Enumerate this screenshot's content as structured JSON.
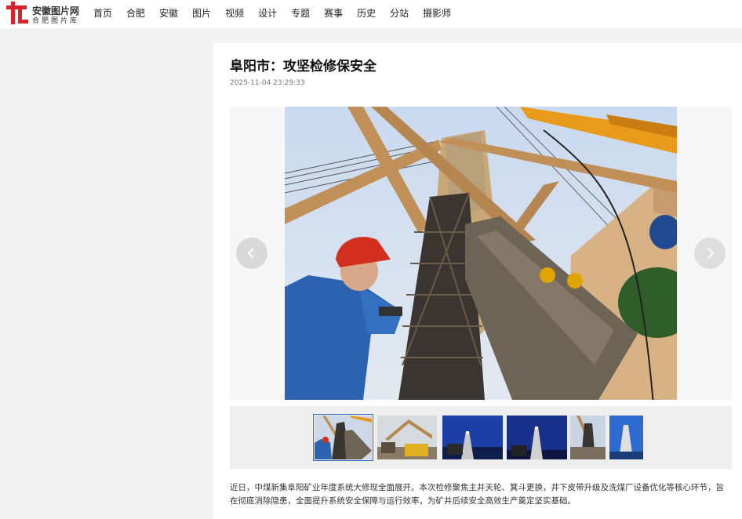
{
  "site": {
    "name": "安徽图片网",
    "sub": "合肥图片库",
    "logo_color": "#d8232a"
  },
  "nav": {
    "items": [
      "首页",
      "合肥",
      "安徽",
      "图片",
      "视频",
      "设计",
      "专题",
      "赛事",
      "历史",
      "分站",
      "摄影师"
    ]
  },
  "article": {
    "title": "阜阳市：攻坚检修保安全",
    "date": "2025-11-04 23:29:33",
    "body": "近日，中煤新集阜阳矿业年度系统大修现全面展开。本次检修聚焦主井天轮、箕斗更换，井下皮带升级及洗煤厂设备优化等核心环节，旨在彻底消除隐患，全面提升系统安全保障与运行效率，为矿井后续安全高效生产奠定坚实基础。"
  },
  "gallery": {
    "prev_icon": "chevron-left-icon",
    "next_icon": "chevron-right-icon",
    "thumbnail_count": 6,
    "active_index": 0,
    "active_color": "#2e6fc9"
  }
}
